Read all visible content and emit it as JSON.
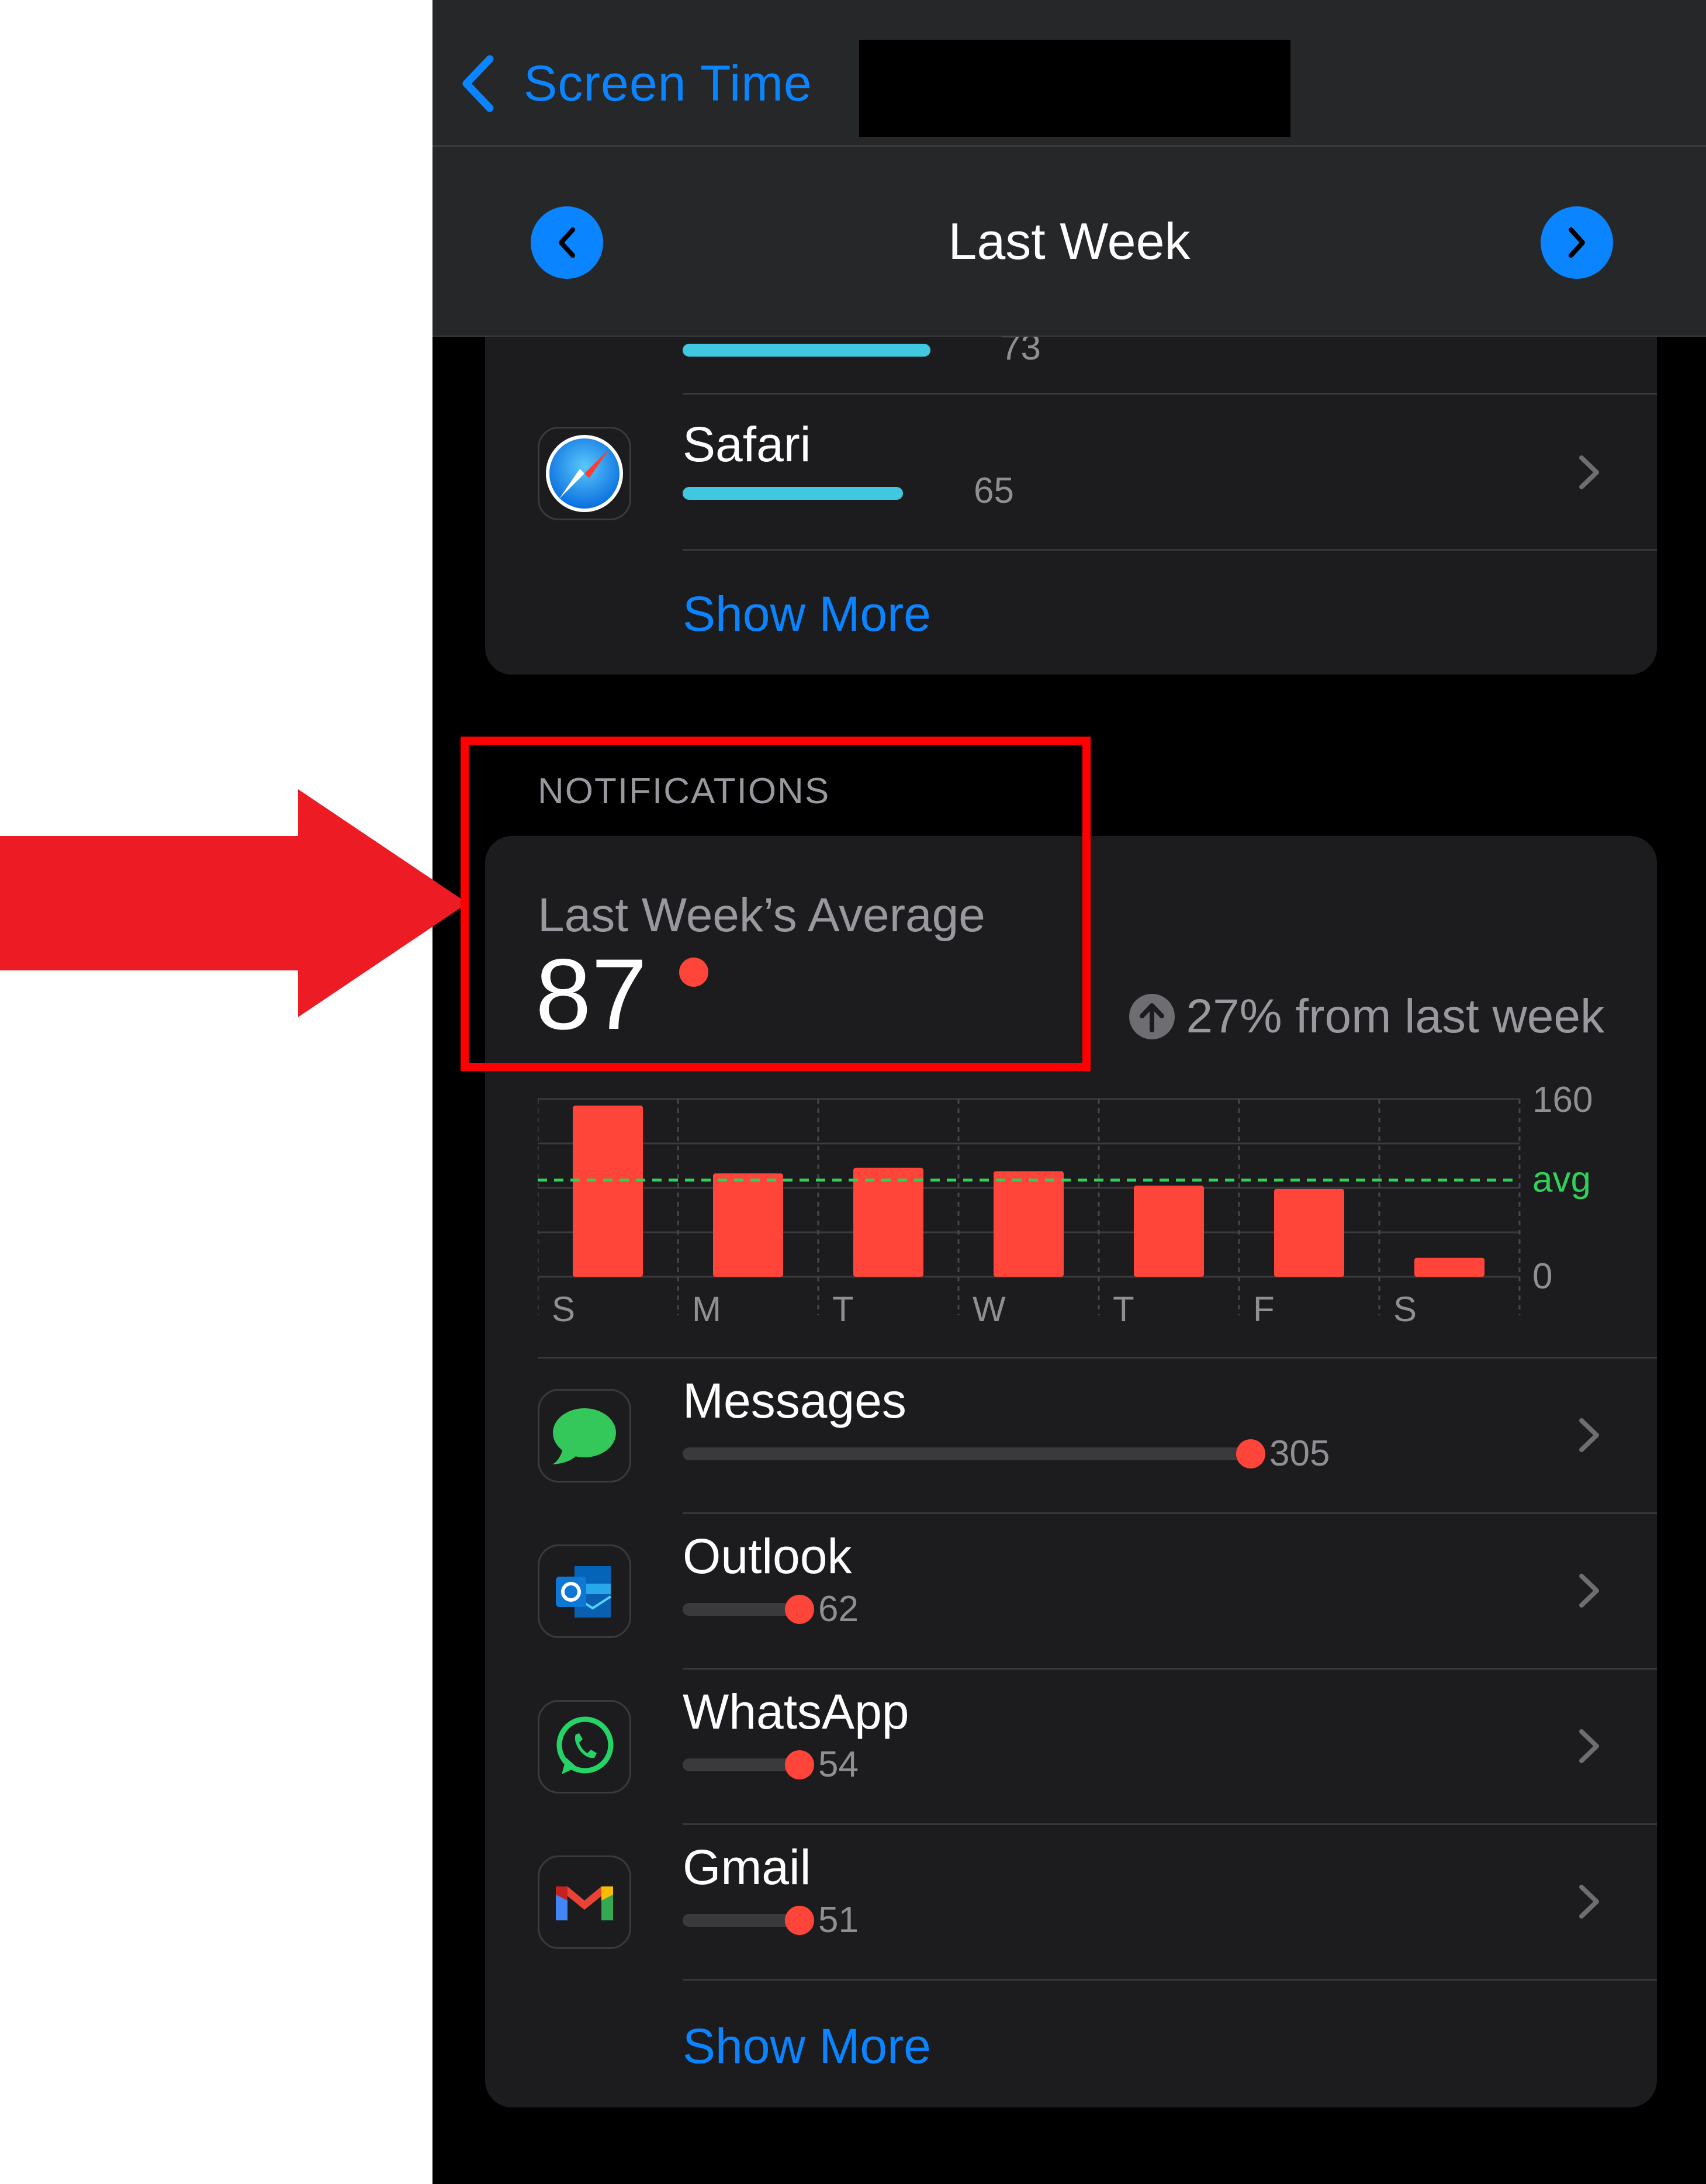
{
  "header": {
    "back_label": "Screen Time",
    "period_title": "Last Week"
  },
  "top_list": {
    "items": [
      {
        "name": "",
        "count": "73",
        "fraction": 1.0,
        "icon": "whatsapp-icon"
      },
      {
        "name": "Safari",
        "count": "65",
        "fraction": 0.89,
        "icon": "safari-icon"
      }
    ],
    "show_more": "Show More"
  },
  "notifications": {
    "section_label": "NOTIFICATIONS",
    "average_label": "Last Week’s Average",
    "average_value": "87",
    "change_text": "27% from last week",
    "change_direction": "up",
    "apps": [
      {
        "name": "Messages",
        "count": "305",
        "value": 305,
        "icon": "messages-icon"
      },
      {
        "name": "Outlook",
        "count": "62",
        "value": 62,
        "icon": "outlook-icon"
      },
      {
        "name": "WhatsApp",
        "count": "54",
        "value": 54,
        "icon": "whatsapp-icon"
      },
      {
        "name": "Gmail",
        "count": "51",
        "value": 51,
        "icon": "gmail-icon"
      }
    ],
    "show_more": "Show More"
  },
  "chart_data": {
    "type": "bar",
    "categories": [
      "S",
      "M",
      "T",
      "W",
      "T",
      "F",
      "S"
    ],
    "values": [
      154,
      93,
      98,
      95,
      82,
      79,
      17
    ],
    "ylim": [
      0,
      160
    ],
    "ytick_labels": [
      "160",
      "0"
    ],
    "average": 87,
    "average_label": "avg",
    "bar_color": "#ff453a",
    "average_color": "#30d158",
    "grid": true
  },
  "colors": {
    "accent": "#0a84ff",
    "notification_red": "#ff453a",
    "screen_time_bar": "#40c8e0",
    "annotation_red": "#ff0000",
    "arrow_red": "#ed1c24"
  }
}
